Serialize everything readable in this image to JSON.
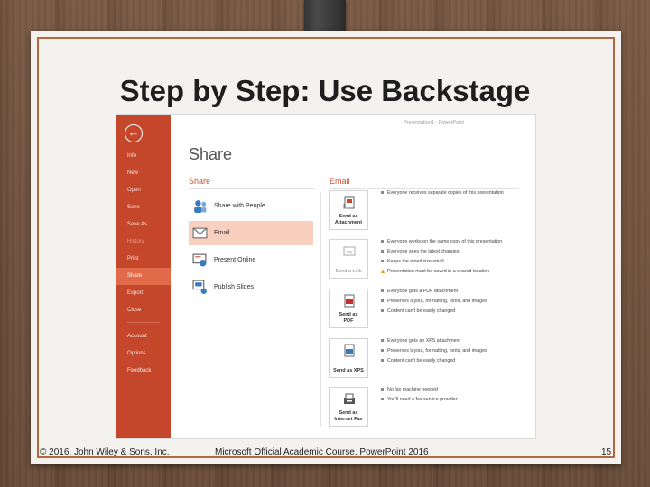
{
  "slide": {
    "title": "Step by Step: Use Backstage",
    "footer_left": "© 2016, John Wiley & Sons, Inc.",
    "footer_center": "Microsoft Official Academic Course, PowerPoint 2016",
    "page_number": "15"
  },
  "app": {
    "window_title": "Presentation1 - PowerPoint",
    "accent_color": "#c4462b",
    "sidebar": {
      "back_icon": "back-arrow-icon",
      "items": [
        {
          "label": "Info",
          "state": "normal"
        },
        {
          "label": "New",
          "state": "normal"
        },
        {
          "label": "Open",
          "state": "normal"
        },
        {
          "label": "Save",
          "state": "normal"
        },
        {
          "label": "Save As",
          "state": "normal"
        },
        {
          "label": "History",
          "state": "dim"
        },
        {
          "label": "Print",
          "state": "normal"
        },
        {
          "label": "Share",
          "state": "active"
        },
        {
          "label": "Export",
          "state": "normal"
        },
        {
          "label": "Close",
          "state": "normal"
        },
        {
          "label": "Account",
          "state": "normal"
        },
        {
          "label": "Options",
          "state": "normal"
        },
        {
          "label": "Feedback",
          "state": "normal"
        }
      ]
    },
    "heading": "Share",
    "share_section": {
      "label": "Share",
      "options": [
        {
          "label": "Share with People",
          "icon": "share-people-icon",
          "selected": false
        },
        {
          "label": "Email",
          "icon": "email-icon",
          "selected": true
        },
        {
          "label": "Present Online",
          "icon": "present-online-icon",
          "selected": false
        },
        {
          "label": "Publish Slides",
          "icon": "publish-slides-icon",
          "selected": false
        }
      ]
    },
    "email_section": {
      "label": "Email",
      "actions": [
        {
          "label_line1": "Send as",
          "label_line2": "Attachment",
          "icon": "attachment-icon",
          "enabled": true,
          "bullets": [
            {
              "text": "Everyone receives separate copies of this presentation",
              "warning": false
            }
          ]
        },
        {
          "label_line1": "Send a Link",
          "label_line2": "",
          "icon": "link-icon",
          "enabled": false,
          "bullets": [
            {
              "text": "Everyone works on the same copy of this presentation",
              "warning": false
            },
            {
              "text": "Everyone sees the latest changes",
              "warning": false
            },
            {
              "text": "Keeps the email size small",
              "warning": false
            },
            {
              "text": "Presentation must be saved in a shared location",
              "warning": true
            }
          ]
        },
        {
          "label_line1": "Send as",
          "label_line2": "PDF",
          "icon": "pdf-icon",
          "enabled": true,
          "bullets": [
            {
              "text": "Everyone gets a PDF attachment",
              "warning": false
            },
            {
              "text": "Preserves layout, formatting, fonts, and images",
              "warning": false
            },
            {
              "text": "Content can't be easily changed",
              "warning": false
            }
          ]
        },
        {
          "label_line1": "Send as XPS",
          "label_line2": "",
          "icon": "xps-icon",
          "enabled": true,
          "bullets": [
            {
              "text": "Everyone gets an XPS attachment",
              "warning": false
            },
            {
              "text": "Preserves layout, formatting, fonts, and images",
              "warning": false
            },
            {
              "text": "Content can't be easily changed",
              "warning": false
            }
          ]
        },
        {
          "label_line1": "Send as",
          "label_line2": "Internet Fax",
          "icon": "fax-icon",
          "enabled": true,
          "bullets": [
            {
              "text": "No fax machine needed",
              "warning": false
            },
            {
              "text": "You'll need a fax service provider",
              "warning": false
            }
          ]
        }
      ]
    }
  }
}
